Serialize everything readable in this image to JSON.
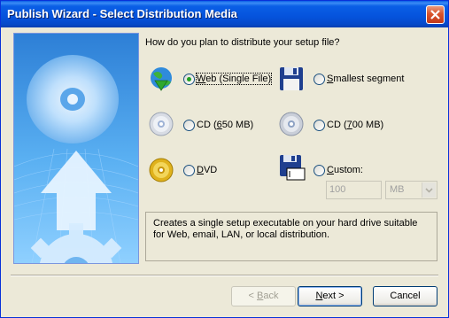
{
  "window": {
    "title": "Publish Wizard - Select Distribution Media"
  },
  "question": "How do you plan to distribute your setup file?",
  "options": {
    "web": {
      "label_pre": "",
      "mnemonic": "W",
      "label_post": "eb (Single File)",
      "selected": true
    },
    "smallest": {
      "label_pre": "",
      "mnemonic": "S",
      "label_post": "mallest segment",
      "selected": false
    },
    "cd650": {
      "label_pre": "CD (",
      "mnemonic": "6",
      "label_post": "50 MB)",
      "selected": false
    },
    "cd700": {
      "label_pre": "CD (",
      "mnemonic": "7",
      "label_post": "00 MB)",
      "selected": false
    },
    "dvd": {
      "label_pre": "",
      "mnemonic": "D",
      "label_post": "VD",
      "selected": false
    },
    "custom": {
      "label_pre": "",
      "mnemonic": "C",
      "label_post": "ustom:",
      "selected": false
    }
  },
  "custom_size": {
    "value": "100",
    "unit": "MB"
  },
  "description": "Creates a single setup executable on your hard drive suitable for Web, email, LAN, or local distribution.",
  "buttons": {
    "back": {
      "pre": "< ",
      "mnemonic": "B",
      "post": "ack"
    },
    "next": {
      "pre": "",
      "mnemonic": "N",
      "post": "ext >"
    },
    "cancel": "Cancel"
  },
  "icons": {
    "web": "globe-download-icon",
    "smallest": "floppy-disk-icon",
    "cd650": "cd-icon",
    "cd700": "cd-icon",
    "dvd": "dvd-icon",
    "custom": "floppy-custom-icon"
  },
  "colors": {
    "title_bar": "#0553dc",
    "dialog_bg": "#ece9d8",
    "accent": "#21a121"
  }
}
